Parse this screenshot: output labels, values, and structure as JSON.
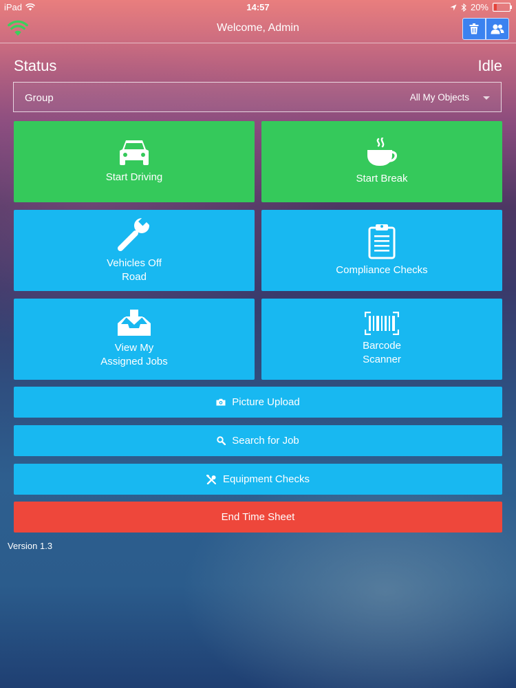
{
  "status_bar": {
    "device": "iPad",
    "time": "14:57",
    "battery": "20%",
    "battery_level": 0.2
  },
  "navbar": {
    "title": "Welcome, Admin"
  },
  "status": {
    "label": "Status",
    "value": "Idle"
  },
  "group": {
    "label": "Group",
    "value": "All My Objects"
  },
  "tiles": {
    "start_driving": "Start Driving",
    "start_break": "Start Break",
    "vehicles_off_road": [
      "Vehicles Off",
      "Road"
    ],
    "compliance_checks": "Compliance Checks",
    "view_jobs": [
      "View My",
      "Assigned Jobs"
    ],
    "barcode": [
      "Barcode",
      "Scanner"
    ]
  },
  "buttons": {
    "picture_upload": "Picture Upload",
    "search_job": "Search for Job",
    "equipment_checks": "Equipment Checks",
    "end_time_sheet": "End Time Sheet"
  },
  "version": "Version 1.3",
  "colors": {
    "green": "#35c95b",
    "blue": "#18b8f1",
    "red": "#ee473b",
    "nav_button": "#3b82f0"
  },
  "icons": [
    "wifi-icon",
    "trash-icon",
    "users-icon",
    "car-icon",
    "coffee-icon",
    "wrench-icon",
    "clipboard-icon",
    "inbox-download-icon",
    "barcode-icon",
    "camera-icon",
    "search-icon",
    "tools-icon"
  ]
}
